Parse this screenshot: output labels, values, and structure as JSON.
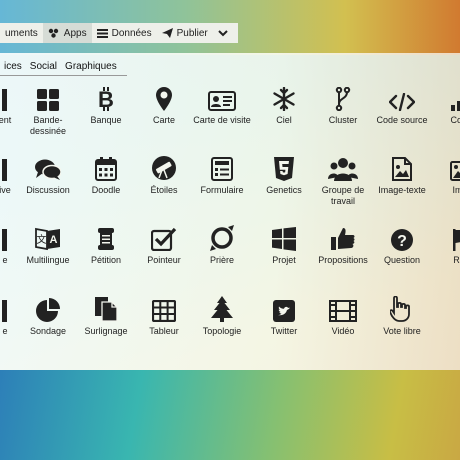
{
  "toolbar": {
    "items": [
      {
        "label": "uments",
        "icon": ""
      },
      {
        "label": "Apps",
        "icon": "apps-icon"
      },
      {
        "label": "Données",
        "icon": "list-icon"
      },
      {
        "label": "Publier",
        "icon": "send-icon"
      }
    ],
    "more_icon": "chevron-down-icon"
  },
  "subtabs": [
    "ices",
    "Social",
    "Graphiques"
  ],
  "rows": [
    [
      {
        "label": "ent",
        "icon": "partial-icon"
      },
      {
        "label": "Bande-dessinée",
        "icon": "grid-squares-icon"
      },
      {
        "label": "Banque",
        "icon": "bitcoin-icon"
      },
      {
        "label": "Carte",
        "icon": "map-pin-icon"
      },
      {
        "label": "Carte de visite",
        "icon": "id-card-icon"
      },
      {
        "label": "Ciel",
        "icon": "snowflake-icon"
      },
      {
        "label": "Cluster",
        "icon": "branch-icon"
      },
      {
        "label": "Code source",
        "icon": "code-icon"
      },
      {
        "label": "Com",
        "icon": "bars-icon"
      }
    ],
    [
      {
        "label": "ive",
        "icon": "partial-icon"
      },
      {
        "label": "Discussion",
        "icon": "chat-icon"
      },
      {
        "label": "Doodle",
        "icon": "calendar-icon"
      },
      {
        "label": "Étoiles",
        "icon": "telescope-icon"
      },
      {
        "label": "Formulaire",
        "icon": "form-icon"
      },
      {
        "label": "Genetics",
        "icon": "html5-icon"
      },
      {
        "label": "Groupe de travail",
        "icon": "users-icon"
      },
      {
        "label": "Image-texte",
        "icon": "image-file-icon"
      },
      {
        "label": "Ima",
        "icon": "image-icon"
      }
    ],
    [
      {
        "label": "e",
        "icon": "partial-icon"
      },
      {
        "label": "Multilingue",
        "icon": "language-icon"
      },
      {
        "label": "Pétition",
        "icon": "scroll-icon"
      },
      {
        "label": "Pointeur",
        "icon": "check-square-icon"
      },
      {
        "label": "Prière",
        "icon": "ring-icon"
      },
      {
        "label": "Projet",
        "icon": "windows-icon"
      },
      {
        "label": "Propositions",
        "icon": "thumbs-up-icon"
      },
      {
        "label": "Question",
        "icon": "question-icon"
      },
      {
        "label": "Rel",
        "icon": "flag-icon"
      }
    ],
    [
      {
        "label": "e",
        "icon": "partial-icon"
      },
      {
        "label": "Sondage",
        "icon": "pie-icon"
      },
      {
        "label": "Surlignage",
        "icon": "doc-icon"
      },
      {
        "label": "Tableur",
        "icon": "table-icon"
      },
      {
        "label": "Topologie",
        "icon": "tree-icon"
      },
      {
        "label": "Twitter",
        "icon": "twitter-icon"
      },
      {
        "label": "Vidéo",
        "icon": "film-icon"
      },
      {
        "label": "Vote libre",
        "icon": "hand-icon"
      }
    ]
  ]
}
